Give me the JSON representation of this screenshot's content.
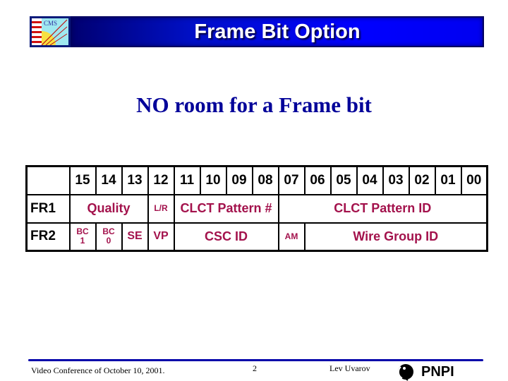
{
  "header": {
    "logo": "cms-logo",
    "title": "Frame Bit Option",
    "colors": {
      "title_bar_dark": "#000070",
      "title_bar_light": "#0000ff",
      "title_text": "#ffffff"
    }
  },
  "subtitle": "NO room for a Frame bit",
  "table": {
    "bit_headers": [
      "15",
      "14",
      "13",
      "12",
      "11",
      "10",
      "09",
      "08",
      "07",
      "06",
      "05",
      "04",
      "03",
      "02",
      "01",
      "00"
    ],
    "rows": [
      {
        "label": "FR1",
        "fields": [
          {
            "label": "Quality",
            "bits": "15-13"
          },
          {
            "label": "L/R",
            "bits": "12"
          },
          {
            "label": "CLCT Pattern #",
            "bits": "11-08"
          },
          {
            "label": "CLCT Pattern ID",
            "bits": "07-00"
          }
        ]
      },
      {
        "label": "FR2",
        "fields": [
          {
            "label": "BC",
            "label2": "1",
            "bits": "15"
          },
          {
            "label": "BC",
            "label2": "0",
            "bits": "14"
          },
          {
            "label": "SE",
            "bits": "13"
          },
          {
            "label": "VP",
            "bits": "12"
          },
          {
            "label": "CSC ID",
            "bits": "11-08"
          },
          {
            "label": "AM",
            "bits": "07"
          },
          {
            "label": "Wire Group ID",
            "bits": "06-00"
          }
        ]
      }
    ],
    "field_color": "#a3124c"
  },
  "footer": {
    "conference": "Video Conference of October 10, 2001.",
    "page": "2",
    "author": "Lev Uvarov",
    "org": "PNPI",
    "line_color": "#0000aa"
  }
}
